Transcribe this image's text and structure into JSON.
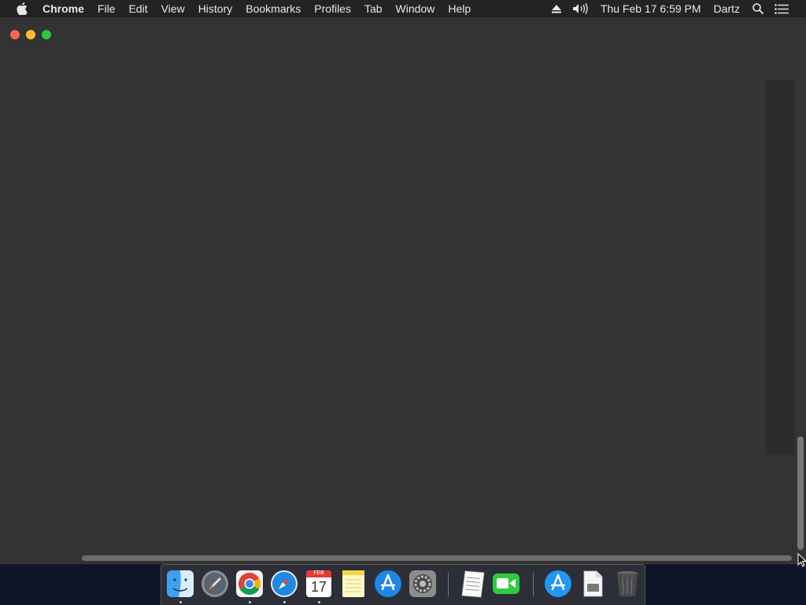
{
  "menubar": {
    "app_name": "Chrome",
    "items": [
      "File",
      "Edit",
      "View",
      "History",
      "Bookmarks",
      "Profiles",
      "Tab",
      "Window",
      "Help"
    ],
    "datetime": "Thu Feb 17  6:59 PM",
    "user": "Dartz",
    "icons": [
      "apple-logo",
      "eject-icon",
      "volume-icon",
      "spotlight-search-icon",
      "notification-center-icon"
    ]
  },
  "dock": {
    "apps": [
      "Finder",
      "Launchpad",
      "Google Chrome",
      "Safari",
      "Calendar",
      "Notes",
      "App Store",
      "System Preferences",
      "TextEdit",
      "FaceTime",
      "App Store Downloads",
      "Document",
      "Trash"
    ],
    "calendar": {
      "month": "FEB",
      "day": "17"
    }
  },
  "colors": {
    "menubar": "#232323",
    "window_bg": "#333333",
    "close": "#ff5f57",
    "minimize": "#febc2e",
    "maximize": "#28c840"
  }
}
